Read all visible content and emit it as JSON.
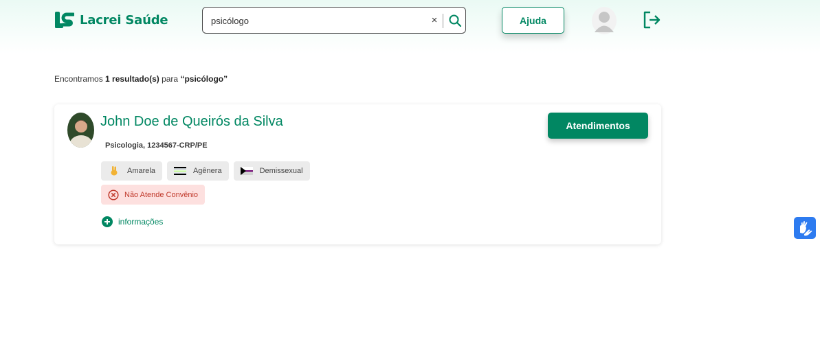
{
  "header": {
    "logo_text": "Lacrei Saúde",
    "search_value": "psicólogo",
    "clear_glyph": "×",
    "help_label": "Ajuda",
    "brand_color": "#018762"
  },
  "results": {
    "prefix": "Encontramos",
    "count_label": "1 resultado(s)",
    "middle": "para",
    "query": "“psicólogo”"
  },
  "professional": {
    "name": "John Doe de Queirós da Silva",
    "specialty": "Psicologia, 1234567-CRP/PE",
    "action_label": "Atendimentos",
    "tags": [
      {
        "label": "Amarela",
        "icon": "hand-emoji-icon"
      },
      {
        "label": "Agênera",
        "icon": "agender-flag-icon"
      },
      {
        "label": "Demissexual",
        "icon": "demisexual-flag-icon"
      }
    ],
    "insurance_label": "Não Atende Convênio",
    "more_label": "informações"
  }
}
